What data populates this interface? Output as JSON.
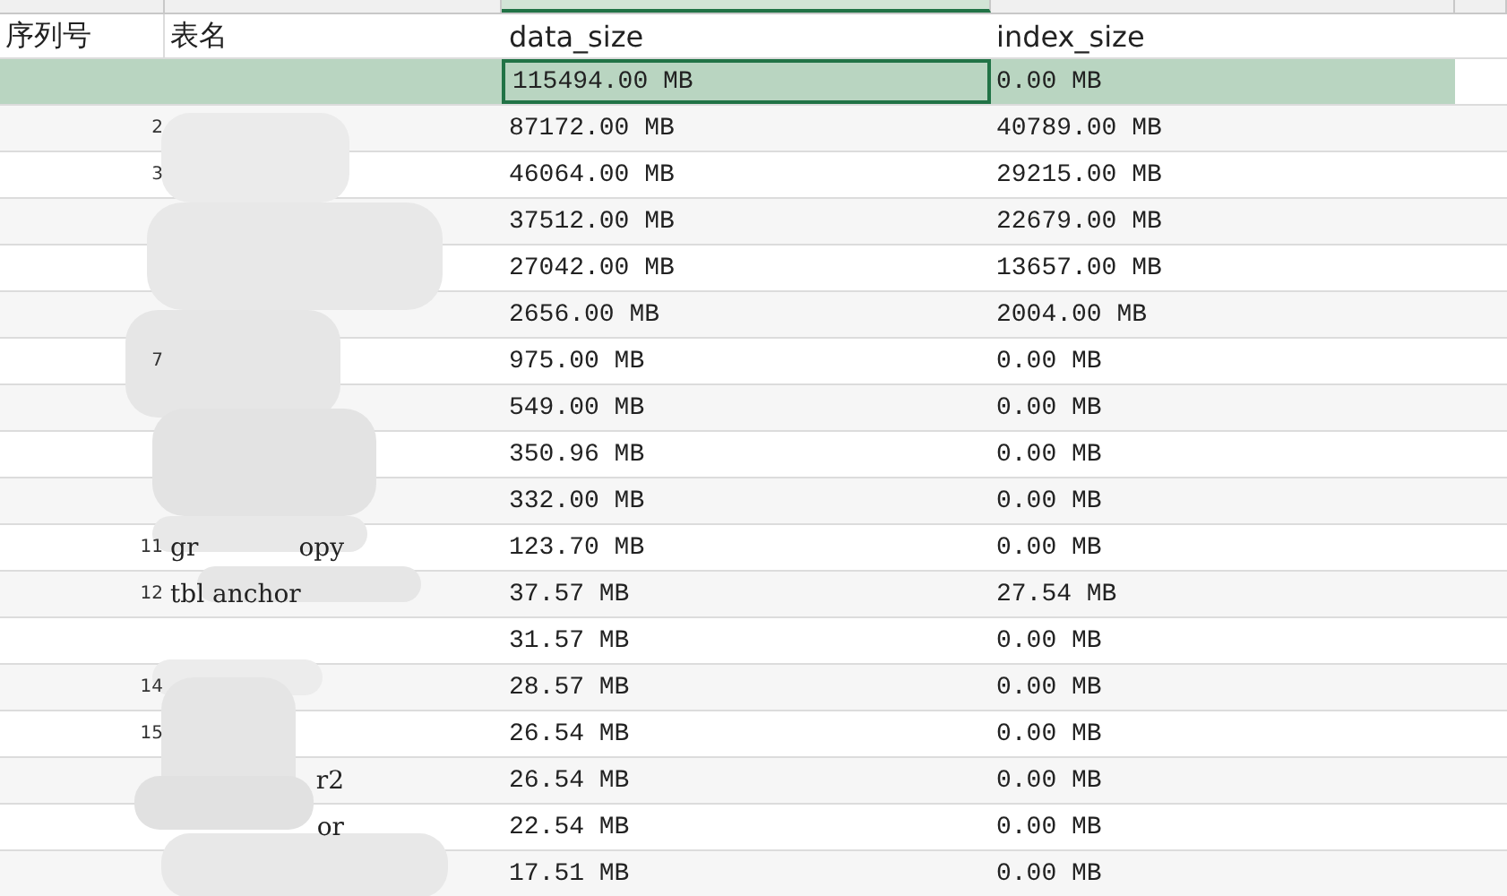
{
  "columns": [
    {
      "label": "序列号"
    },
    {
      "label": "表名"
    },
    {
      "label": "data_size"
    },
    {
      "label": "index_size"
    }
  ],
  "rows": [
    {
      "no": "",
      "name": "",
      "name_end": "",
      "data_size": "115494.00 MB",
      "index_size": "0.00 MB",
      "selected": true
    },
    {
      "no": "2",
      "name": "",
      "name_end": "",
      "data_size": "87172.00 MB",
      "index_size": "40789.00 MB",
      "selected": false
    },
    {
      "no": "3",
      "name": "",
      "name_end": "",
      "data_size": "46064.00 MB",
      "index_size": "29215.00 MB",
      "selected": false
    },
    {
      "no": "",
      "name": "",
      "name_end": "",
      "data_size": "37512.00 MB",
      "index_size": "22679.00 MB",
      "selected": false
    },
    {
      "no": "",
      "name": "",
      "name_end": "",
      "data_size": "27042.00 MB",
      "index_size": "13657.00 MB",
      "selected": false
    },
    {
      "no": "",
      "name": "",
      "name_end": "",
      "data_size": "2656.00 MB",
      "index_size": "2004.00 MB",
      "selected": false
    },
    {
      "no": "7",
      "name": "",
      "name_end": "",
      "data_size": "975.00 MB",
      "index_size": "0.00 MB",
      "selected": false
    },
    {
      "no": "",
      "name": "",
      "name_end": "",
      "data_size": "549.00 MB",
      "index_size": "0.00 MB",
      "selected": false
    },
    {
      "no": "",
      "name": "",
      "name_end": "",
      "data_size": "350.96 MB",
      "index_size": "0.00 MB",
      "selected": false
    },
    {
      "no": "",
      "name": "",
      "name_end": "",
      "data_size": "332.00 MB",
      "index_size": "0.00 MB",
      "selected": false
    },
    {
      "no": "11",
      "name": "gr",
      "name_end": "opy",
      "data_size": "123.70 MB",
      "index_size": "0.00 MB",
      "selected": false
    },
    {
      "no": "12",
      "name": "tbl anchor",
      "name_end": "",
      "data_size": "37.57 MB",
      "index_size": "27.54 MB",
      "selected": false
    },
    {
      "no": "",
      "name": "",
      "name_end": "",
      "data_size": "31.57 MB",
      "index_size": "0.00 MB",
      "selected": false
    },
    {
      "no": "14",
      "name": "",
      "name_end": "",
      "data_size": "28.57 MB",
      "index_size": "0.00 MB",
      "selected": false
    },
    {
      "no": "15",
      "name": "",
      "name_end": "",
      "data_size": "26.54 MB",
      "index_size": "0.00 MB",
      "selected": false
    },
    {
      "no": "",
      "name": "",
      "name_end": "r2",
      "data_size": "26.54 MB",
      "index_size": "0.00 MB",
      "selected": false
    },
    {
      "no": "",
      "name": "",
      "name_end": "or",
      "data_size": "22.54 MB",
      "index_size": "0.00 MB",
      "selected": false
    },
    {
      "no": "",
      "name": "",
      "name_end": "",
      "data_size": "17.51 MB",
      "index_size": "0.00 MB",
      "selected": false
    }
  ]
}
